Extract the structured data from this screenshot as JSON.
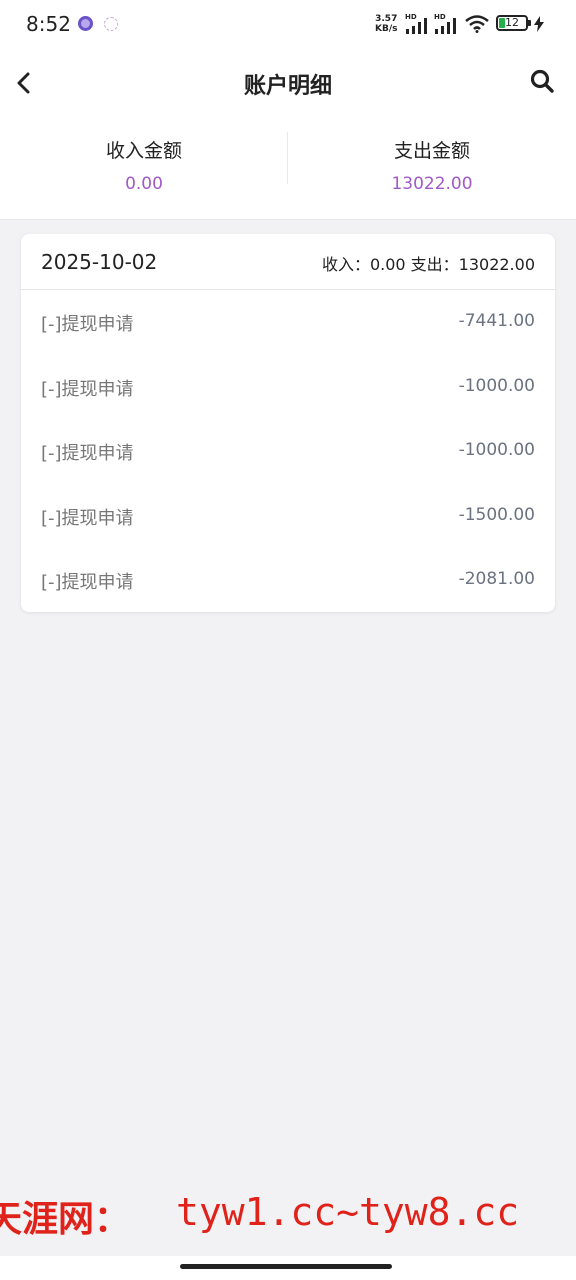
{
  "status_bar": {
    "time": "8:52",
    "net_speed_value": "3.57",
    "net_speed_unit": "KB/s",
    "sim1_label": "HD",
    "sim2_label": "HD",
    "battery": "12",
    "icons": [
      "app-notification-icon",
      "app-notification-icon",
      "signal-icon",
      "signal-icon",
      "wifi-icon",
      "battery-icon",
      "charging-icon"
    ]
  },
  "header": {
    "title": "账户明细",
    "back_icon": "chevron-left-icon",
    "search_icon": "search-icon"
  },
  "summary": {
    "income_label": "收入金额",
    "income_value": "0.00",
    "expense_label": "支出金额",
    "expense_value": "13022.00",
    "value_color": "#a259c8"
  },
  "group": {
    "date": "2025-10-02",
    "summary_text": "收入：0.00 支出：13022.00",
    "items": [
      {
        "label": "[-]提现申请",
        "amount": "-7441.00"
      },
      {
        "label": "[-]提现申请",
        "amount": "-1000.00"
      },
      {
        "label": "[-]提现申请",
        "amount": "-1000.00"
      },
      {
        "label": "[-]提现申请",
        "amount": "-1500.00"
      },
      {
        "label": "[-]提现申请",
        "amount": "-2081.00"
      }
    ]
  },
  "watermark": {
    "name": "天涯网：",
    "url": "tyw1.cc~tyw8.cc",
    "color": "#e0231a"
  }
}
